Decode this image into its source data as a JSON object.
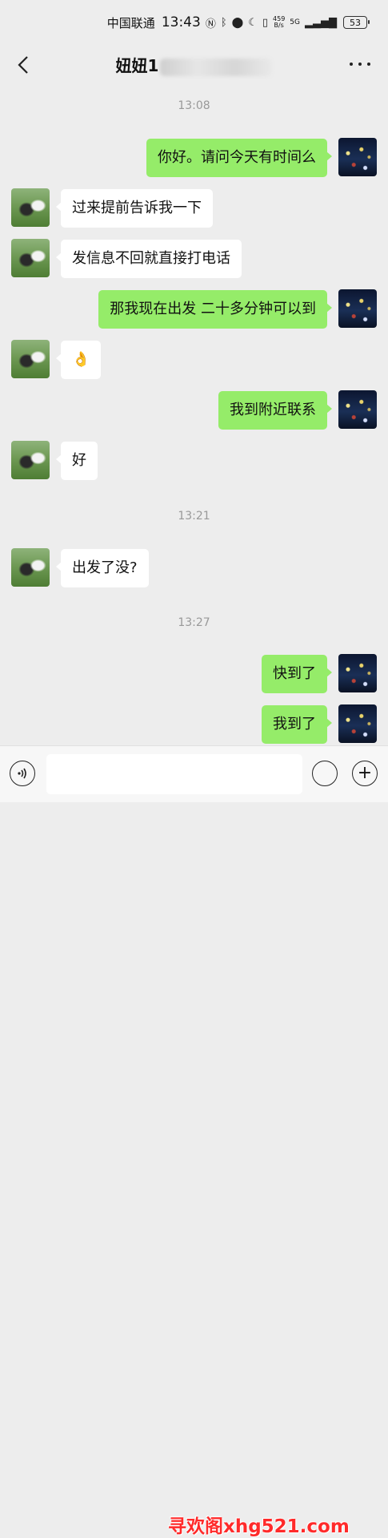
{
  "status_bar": {
    "carrier": "中国联通",
    "time": "13:43",
    "net_speed_value": "459",
    "net_speed_unit": "B/s",
    "network": "5G",
    "battery": "53",
    "icons": [
      "nfc-icon",
      "bluetooth-icon",
      "location-icon",
      "moon-icon",
      "vibrate-icon",
      "signal-icon"
    ]
  },
  "header": {
    "title": "妞妞",
    "title_number_visible": "1"
  },
  "timestamps": [
    "13:08",
    "13:21",
    "13:27"
  ],
  "messages": [
    {
      "from": "me",
      "text": "你好。请问今天有时间么"
    },
    {
      "from": "her",
      "text": "过来提前告诉我一下"
    },
    {
      "from": "her",
      "text": "发信息不回就直接打电话"
    },
    {
      "from": "me",
      "text": "那我现在出发 二十多分钟可以到"
    },
    {
      "from": "her",
      "text": "👌"
    },
    {
      "from": "me",
      "text": "我到附近联系"
    },
    {
      "from": "her",
      "text": "好"
    },
    {
      "from": "her",
      "text": "出发了没?"
    },
    {
      "from": "me",
      "text": "快到了"
    },
    {
      "from": "me",
      "text": "我到了"
    }
  ],
  "input": {
    "value": "",
    "placeholder": ""
  },
  "watermark": "寻欢阁xhg521.com",
  "colors": {
    "background": "#ededed",
    "my_bubble": "#95ec69",
    "her_bubble": "#ffffff",
    "watermark": "#ff2a2a"
  }
}
